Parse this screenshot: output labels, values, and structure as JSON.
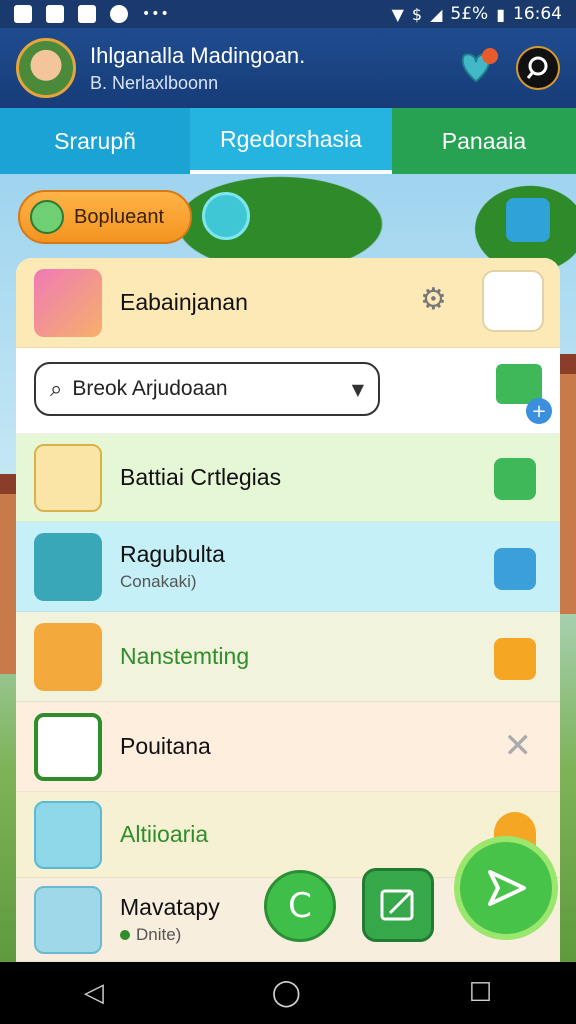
{
  "status_bar": {
    "battery": "5£%",
    "time": "16:64",
    "more": "•••"
  },
  "header": {
    "title": "Ihlganalla Madingoan.",
    "subtitle": "B. Nerlaxlboonn"
  },
  "tabs": [
    {
      "label": "Srarupñ"
    },
    {
      "label": "Rgedorshasia"
    },
    {
      "label": "Panaaia"
    }
  ],
  "pill": {
    "label": "Boplueant"
  },
  "list": {
    "header_row": {
      "title": "Eabainjanan"
    },
    "search": {
      "value": "Breok Arjudoaan"
    },
    "rows": [
      {
        "title": "Battiai Crtlegias",
        "subtitle": ""
      },
      {
        "title": "Ragubulta",
        "subtitle": "Conakaki)"
      },
      {
        "title": "Nanstemting",
        "subtitle": ""
      },
      {
        "title": "Pouitana",
        "subtitle": ""
      },
      {
        "title": "Altiioaria",
        "subtitle": ""
      },
      {
        "title": "Mavatapy",
        "subtitle": "Dnite)"
      }
    ]
  },
  "colors": {
    "header_bg": "#1f4c8f",
    "tab_active": "#25b3e0",
    "tab_green": "#27a152",
    "accent_orange": "#f39421",
    "fab_green": "#48c349"
  }
}
